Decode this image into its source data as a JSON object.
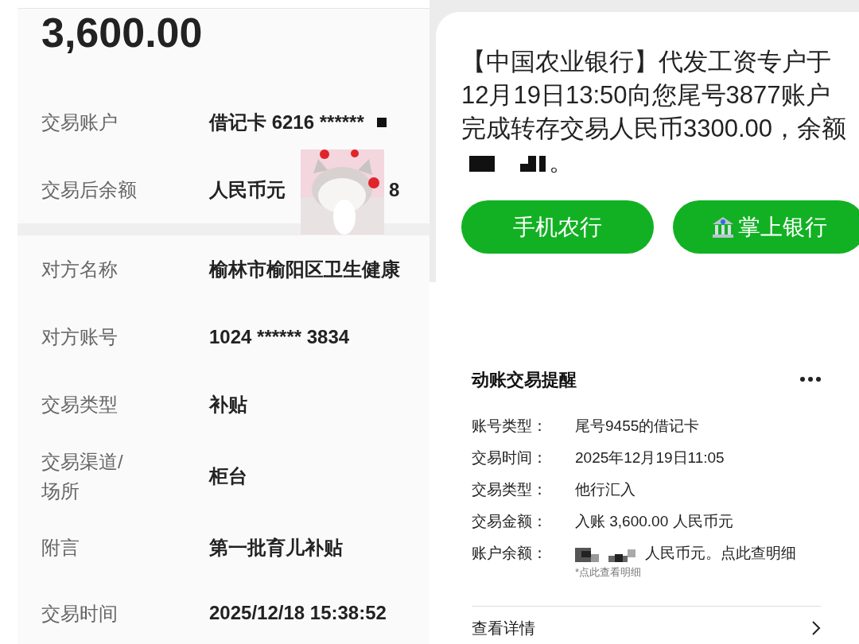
{
  "amount": "3,600.00",
  "account_rows": [
    {
      "label": "交易账户",
      "value": "借记卡 6216 ******",
      "redacted": true
    },
    {
      "label": "交易后余额",
      "value": "人民币元",
      "tail": "8",
      "redacted": false
    }
  ],
  "detail_rows": [
    {
      "label": "对方名称",
      "value": "榆林市榆阳区卫生健康"
    },
    {
      "label": "对方账号",
      "value": "1024 ****** 3834"
    },
    {
      "label": "交易类型",
      "value": "补贴"
    },
    {
      "label": "交易渠道/场所",
      "value": "柜台"
    },
    {
      "label": "附言",
      "value": "第一批育儿补贴"
    },
    {
      "label": "交易时间",
      "value": "2025/12/18 15:38:52"
    }
  ],
  "sms": {
    "lines": [
      "【中国农业银行】代发工资专户于",
      "12月19日13:50向您尾号3877账户",
      "完成转存交易人民币3300.00，余额"
    ],
    "redacted": true,
    "tail": "。"
  },
  "sms_buttons": [
    {
      "label": "手机农行",
      "kind": "plain"
    },
    {
      "label": "掌上银行",
      "kind": "bank_icon"
    }
  ],
  "notice": {
    "title": "动账交易提醒",
    "rows": [
      {
        "label": "账号类型：",
        "value": "尾号9455的借记卡",
        "redacted": false
      },
      {
        "label": "交易时间：",
        "value": "2025年12月19日11:05",
        "redacted": false
      },
      {
        "label": "交易类型：",
        "value": "他行汇入",
        "redacted": false
      },
      {
        "label": "交易金额：",
        "value": "入账 3,600.00 人民币元",
        "redacted": false
      },
      {
        "label": "账户余额：",
        "value": "人民币元。点此查明细",
        "redacted": true
      }
    ],
    "note": "*点此查看明细",
    "link": "查看详情"
  }
}
